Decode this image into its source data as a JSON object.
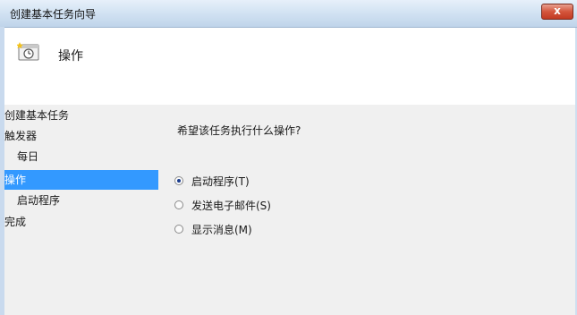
{
  "window": {
    "title": "创建基本任务向导",
    "close_glyph": "x",
    "close_icon": "close-icon"
  },
  "header": {
    "icon": "task-scheduler-icon",
    "title": "操作"
  },
  "steps": [
    {
      "label": "创建基本任务"
    },
    {
      "label": "触发器"
    },
    {
      "label": "每日"
    },
    {
      "label": "操作",
      "active": true
    },
    {
      "label": "启动程序"
    },
    {
      "label": "完成"
    }
  ],
  "question": "希望该任务执行什么操作?",
  "options": [
    {
      "label": "启动程序(T)",
      "checked": true
    },
    {
      "label": "发送电子邮件(S)",
      "checked": false
    },
    {
      "label": "显示消息(M)",
      "checked": false
    }
  ],
  "colors": {
    "titlebar": "#d3e3f3",
    "selection": "#3399ff",
    "close_button": "#c23a22"
  }
}
